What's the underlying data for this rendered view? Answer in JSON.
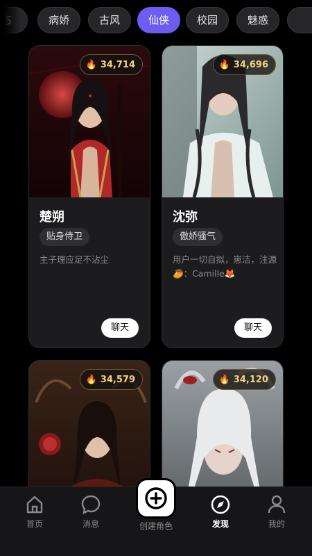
{
  "tabs": [
    {
      "label": "态",
      "active": false
    },
    {
      "label": "病娇",
      "active": false
    },
    {
      "label": "古风",
      "active": false
    },
    {
      "label": "仙侠",
      "active": true
    },
    {
      "label": "校园",
      "active": false
    },
    {
      "label": "魅惑",
      "active": false
    }
  ],
  "cards": [
    {
      "popularity": "34,714",
      "name": "楚朔",
      "tag": "贴身侍卫",
      "desc": "主子理应足不沾尘",
      "chat_label": "聊天"
    },
    {
      "popularity": "34,696",
      "name": "沈弥",
      "tag": "傲娇骚气",
      "desc": "用户一切自拟，崽洁，注源🥭：Camille🦊",
      "chat_label": "聊天"
    },
    {
      "popularity": "34,579"
    },
    {
      "popularity": "34,120"
    }
  ],
  "nav": {
    "home": "首页",
    "messages": "消息",
    "create": "创建角色",
    "discover": "发现",
    "profile": "我的"
  },
  "colors": {
    "accent": "#6c5cf0",
    "badge_text": "#f2d27a"
  }
}
